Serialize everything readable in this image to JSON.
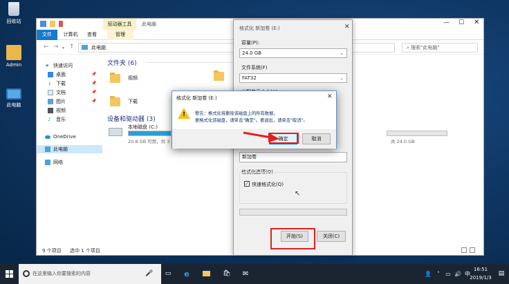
{
  "desktop": {
    "icons": [
      {
        "label": "回收站",
        "icon": "recycle-bin-icon"
      },
      {
        "label": "Admin",
        "icon": "user-folder-icon"
      },
      {
        "label": "此电脑",
        "icon": "this-pc-icon"
      }
    ]
  },
  "explorer": {
    "title": "此电脑",
    "drive_tools_tab": "驱动器工具",
    "ribbon_tabs": [
      "文件",
      "计算机",
      "查看",
      "管理"
    ],
    "address": "此电脑",
    "search_placeholder": "搜索\"此电脑\"",
    "nav": {
      "quick_access": "快速访问",
      "items": [
        "桌面",
        "下载",
        "文档",
        "图片",
        "视频",
        "音乐"
      ],
      "onedrive": "OneDrive",
      "this_pc": "此电脑",
      "network": "网络"
    },
    "folders_header": "文件夹 (6)",
    "folders": [
      "视频",
      "下载"
    ],
    "drives_header": "设备和驱动器 (3)",
    "drive_c": {
      "name": "本地磁盘 (C:)",
      "detail": "20.8 GB 可用，共 3",
      "fill": 0.6
    },
    "drive_e": {
      "detail": "共 24.0 GB"
    },
    "status_items": "9 个项目",
    "status_selected": "选中 1 个项目"
  },
  "format_dialog": {
    "title": "格式化 新加卷 (E:)",
    "capacity_label": "容量(P):",
    "capacity_value": "24.0 GB",
    "fs_label": "文件系统(F)",
    "fs_value": "FAT32",
    "alloc_label": "分配单元大小(A)",
    "volume_value": "新加卷",
    "options_label": "格式化选项(O)",
    "quick_format_label": "快速格式化(Q)",
    "quick_format_checked": true,
    "progress": 0,
    "start_button": "开始(S)",
    "close_button": "关闭(C)"
  },
  "warning_dialog": {
    "title": "格式化 新加卷 (E:)",
    "line1": "警告：格式化将删除该磁盘上的所有数据。",
    "line2": "要格式化该磁盘，请单击\"确定\"。要退出，请单击\"取消\"。",
    "ok_button": "确定",
    "cancel_button": "取消"
  },
  "taskbar": {
    "search_placeholder": "在这里输入你要搜索的内容",
    "time": "16:51",
    "date": "2019/1/3",
    "ime": "中"
  },
  "colors": {
    "highlight": "#e02020",
    "drive_bar": "#26a0da",
    "selection": "#cce8ff"
  }
}
